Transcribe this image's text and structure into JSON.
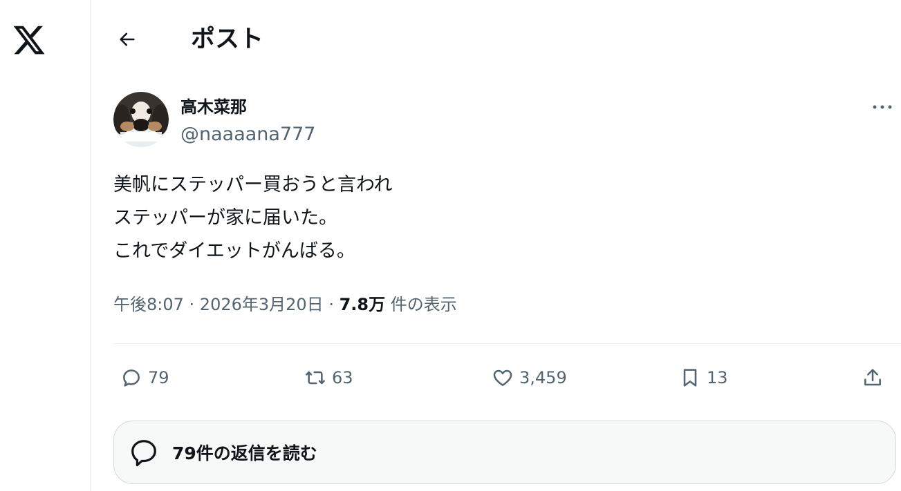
{
  "header": {
    "title": "ポスト"
  },
  "post": {
    "author": {
      "name": "高木菜那",
      "handle": "@naaaana777"
    },
    "text_lines": [
      "美帆にステッパー買おうと言われ",
      "ステッパーが家に届いた。",
      "これでダイエットがんばる。"
    ],
    "meta": {
      "time": "午後8:07",
      "separator": " · ",
      "date": "2026年3月20日",
      "views_count": "7.8万",
      "views_label": " 件の表示"
    }
  },
  "actions": {
    "replies": "79",
    "reposts": "63",
    "likes": "3,459",
    "bookmarks": "13"
  },
  "read_replies_button": {
    "label": "79件の返信を読む"
  },
  "icons": {
    "logo": "x-logo",
    "back": "arrow-left-icon",
    "more": "more-horizontal-icon",
    "reply": "chat-bubble-icon",
    "repost": "repost-icon",
    "like": "heart-icon",
    "bookmark": "bookmark-icon",
    "share": "share-icon"
  },
  "colors": {
    "text_primary": "#0f1419",
    "text_secondary": "#536471",
    "border": "#eff3f4",
    "button_bg": "#f7f9f9"
  }
}
